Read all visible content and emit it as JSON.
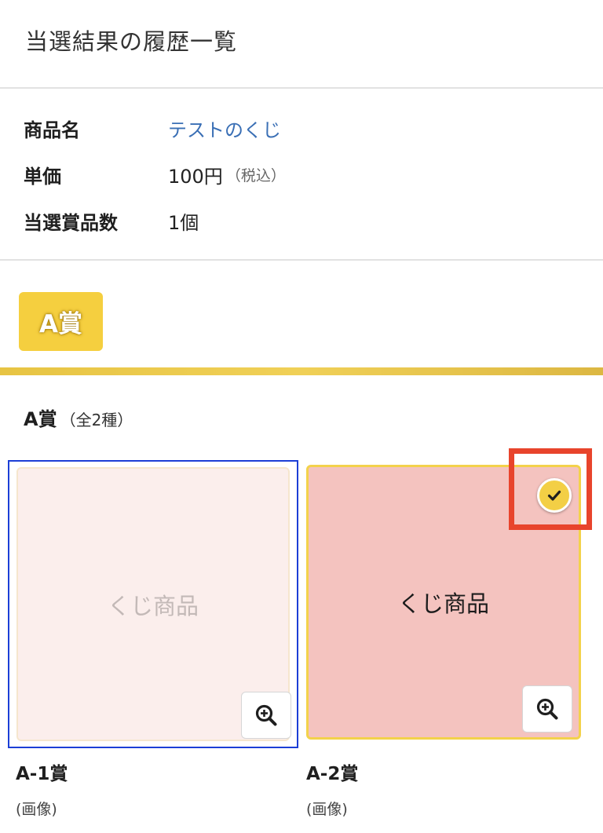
{
  "page": {
    "title": "当選結果の履歴一覧"
  },
  "info": {
    "rows": [
      {
        "label": "商品名",
        "value": "テストのくじ"
      },
      {
        "label": "単価",
        "value": "100円",
        "note": "（税込）"
      },
      {
        "label": "当選賞品数",
        "value": "1個"
      }
    ]
  },
  "prize_section": {
    "badge": "A賞",
    "heading": "A賞",
    "count": "（全2種）",
    "items": [
      {
        "image_text": "くじ商品",
        "name": "A-1賞",
        "sub": "(画像)",
        "won": false
      },
      {
        "image_text": "くじ商品",
        "name": "A-2賞",
        "sub": "(画像)",
        "won": true
      }
    ]
  },
  "icons": {
    "zoom": "zoom-in-icon",
    "check": "check-icon"
  },
  "colors": {
    "accent_yellow": "#f5cf3f",
    "link_blue": "#3a6fb5",
    "selected_border": "#1c3fd6",
    "highlight_red": "#e8442c",
    "won_tile": "#f4c3bf",
    "unwon_tile": "#fbeeec"
  }
}
